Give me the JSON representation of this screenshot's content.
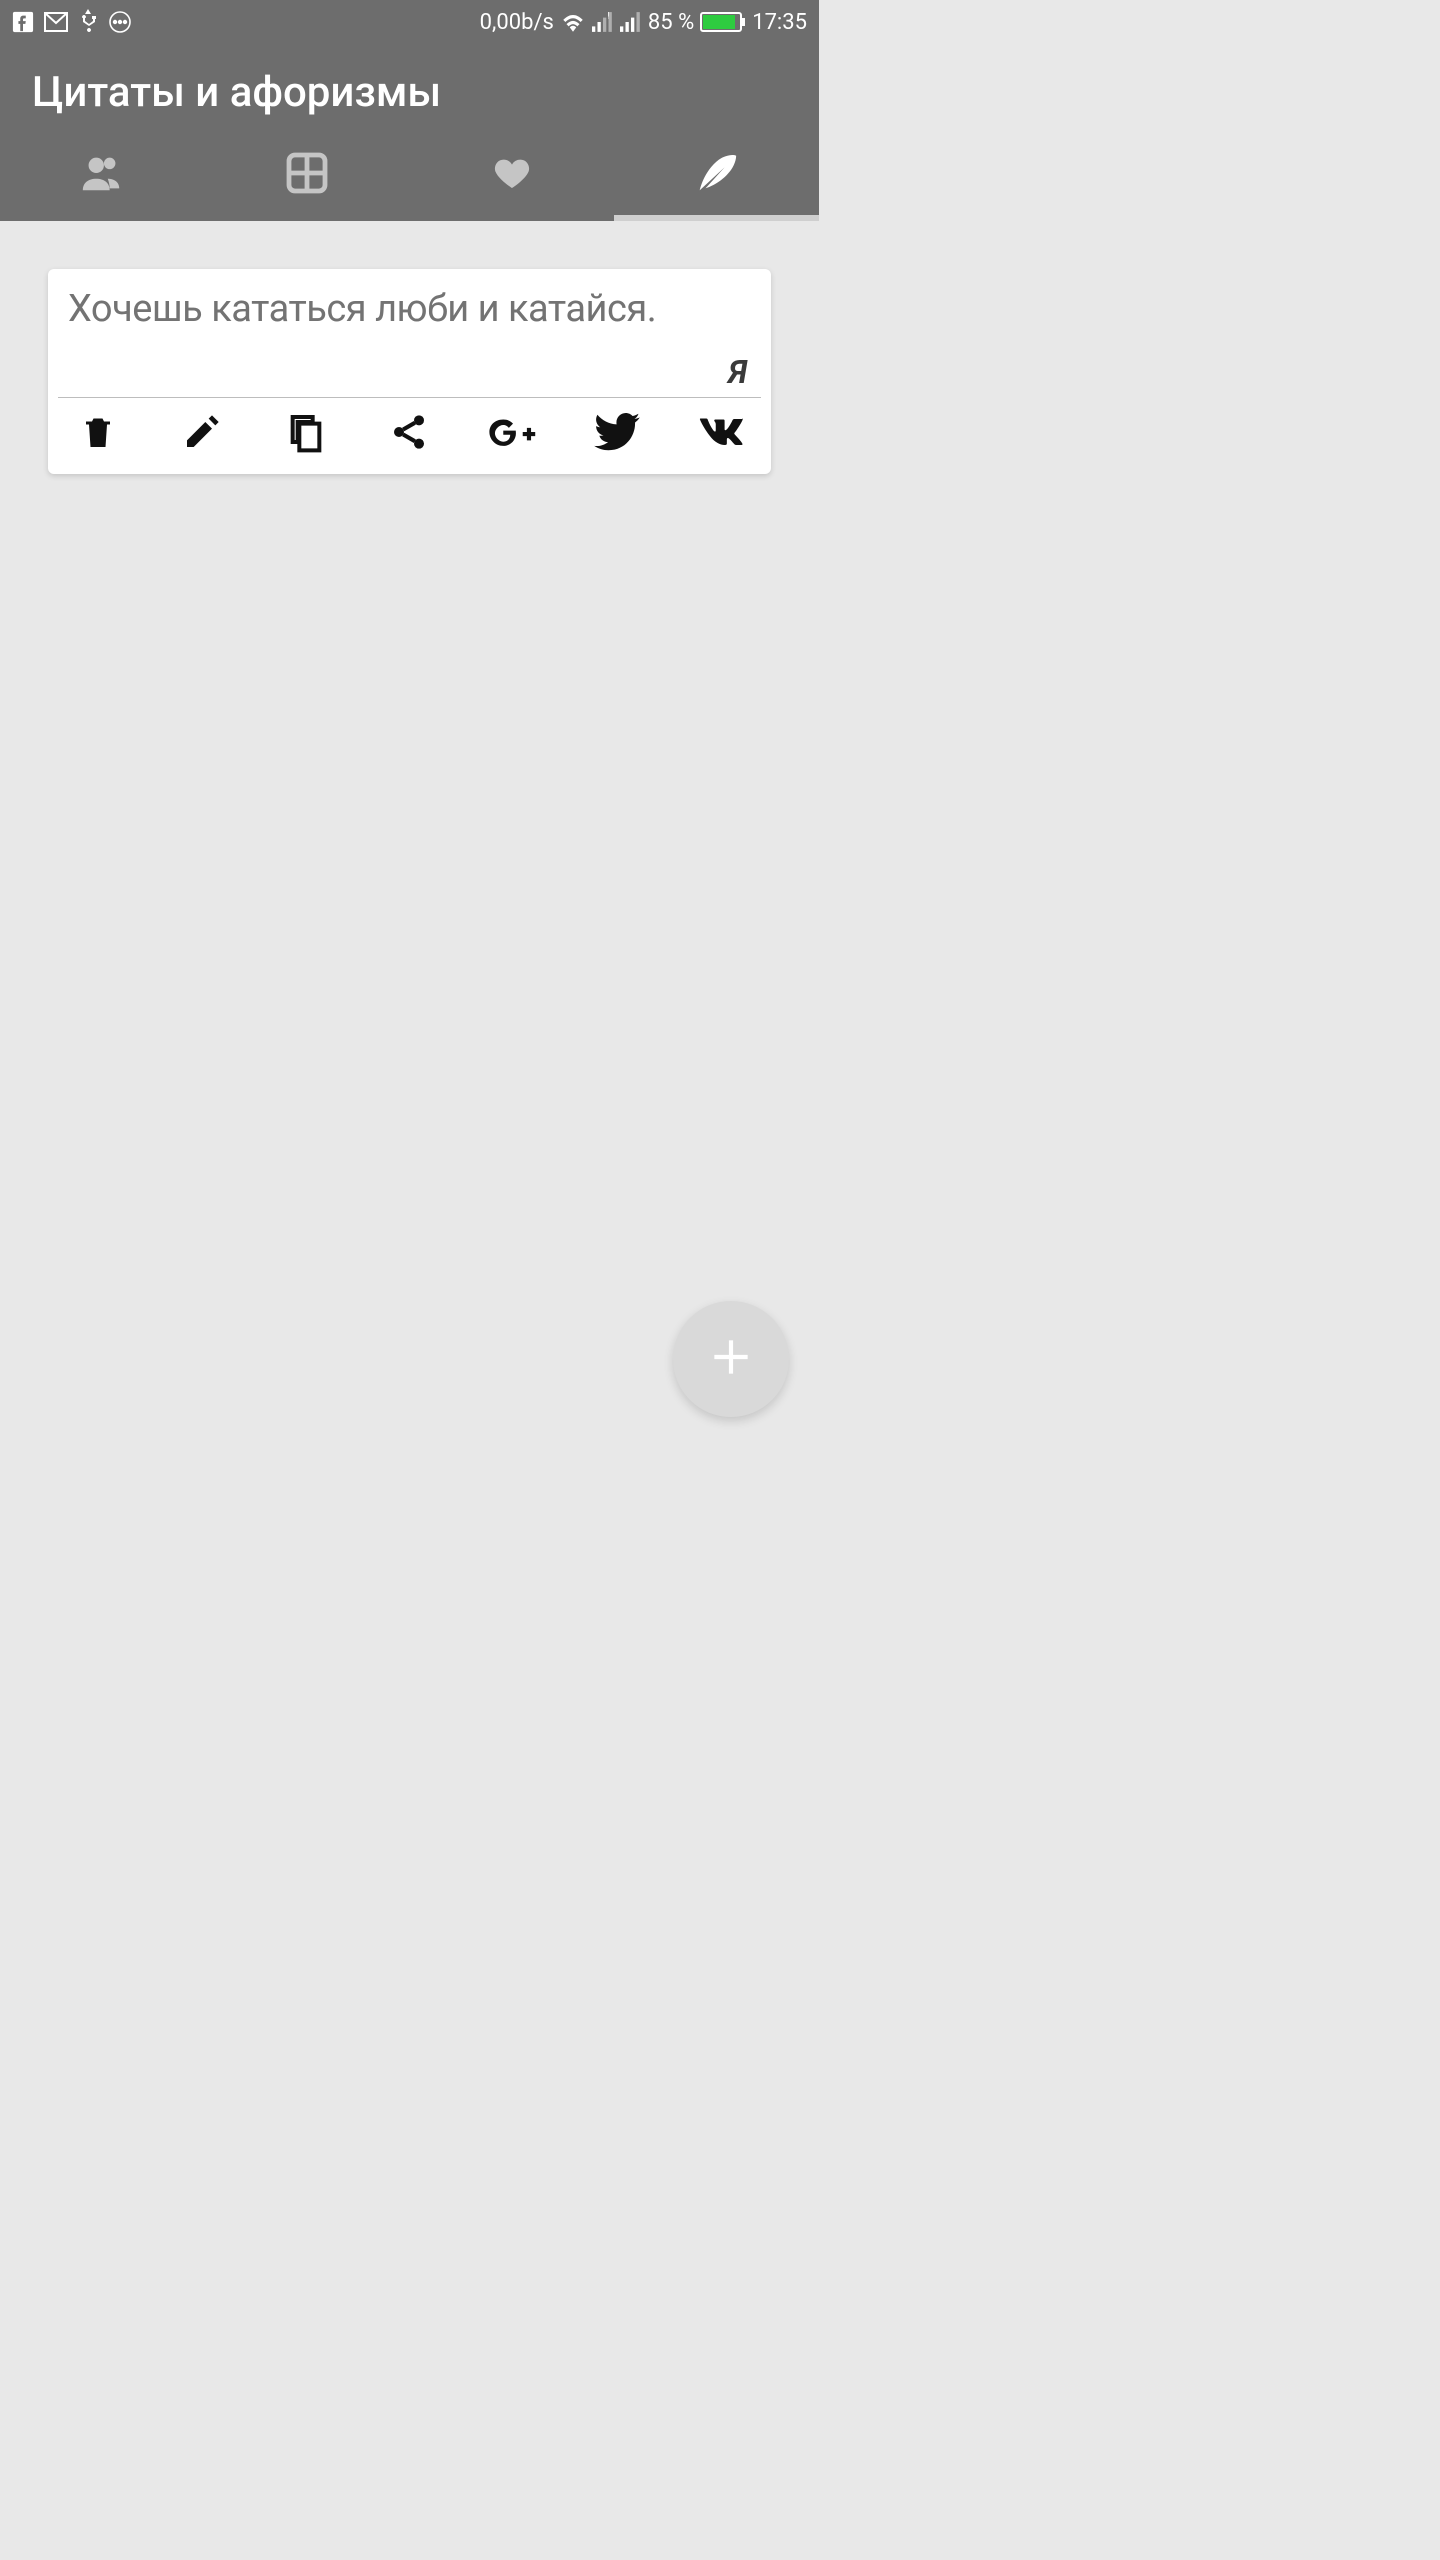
{
  "status": {
    "net_speed": "0,00b/s",
    "battery_pct": "85 %",
    "time": "17:35"
  },
  "header": {
    "title": "Цитаты и афоризмы"
  },
  "tabs": {
    "active_index": 3
  },
  "quote": {
    "text": "Хочешь кататься люби и катайся.",
    "author": "Я"
  }
}
